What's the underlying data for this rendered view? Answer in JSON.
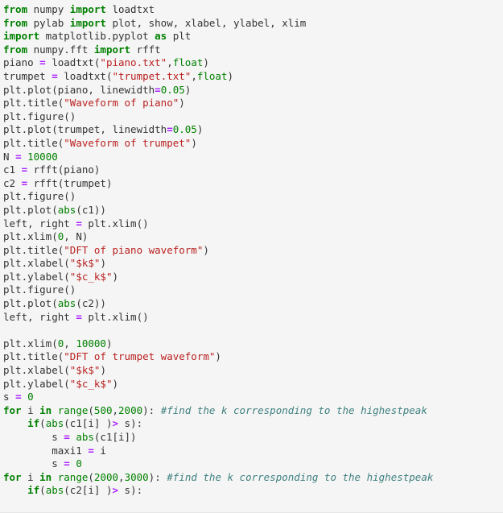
{
  "editor": {
    "language": "python",
    "lines": [
      [
        {
          "t": "kw",
          "v": "from"
        },
        {
          "t": "plain",
          "v": " numpy "
        },
        {
          "t": "kw",
          "v": "import"
        },
        {
          "t": "plain",
          "v": " loadtxt"
        }
      ],
      [
        {
          "t": "kw",
          "v": "from"
        },
        {
          "t": "plain",
          "v": " pylab "
        },
        {
          "t": "kw",
          "v": "import"
        },
        {
          "t": "plain",
          "v": " plot, show, xlabel, ylabel, xlim"
        }
      ],
      [
        {
          "t": "kw",
          "v": "import"
        },
        {
          "t": "plain",
          "v": " matplotlib.pyplot "
        },
        {
          "t": "kw",
          "v": "as"
        },
        {
          "t": "plain",
          "v": " plt"
        }
      ],
      [
        {
          "t": "kw",
          "v": "from"
        },
        {
          "t": "plain",
          "v": " numpy.fft "
        },
        {
          "t": "kw",
          "v": "import"
        },
        {
          "t": "plain",
          "v": " rfft"
        }
      ],
      [
        {
          "t": "plain",
          "v": "piano "
        },
        {
          "t": "op",
          "v": "="
        },
        {
          "t": "plain",
          "v": " loadtxt("
        },
        {
          "t": "str",
          "v": "\"piano.txt\""
        },
        {
          "t": "plain",
          "v": ","
        },
        {
          "t": "bi",
          "v": "float"
        },
        {
          "t": "plain",
          "v": ")"
        }
      ],
      [
        {
          "t": "plain",
          "v": "trumpet "
        },
        {
          "t": "op",
          "v": "="
        },
        {
          "t": "plain",
          "v": " loadtxt("
        },
        {
          "t": "str",
          "v": "\"trumpet.txt\""
        },
        {
          "t": "plain",
          "v": ","
        },
        {
          "t": "bi",
          "v": "float"
        },
        {
          "t": "plain",
          "v": ")"
        }
      ],
      [
        {
          "t": "plain",
          "v": "plt.plot(piano, linewidth"
        },
        {
          "t": "op",
          "v": "="
        },
        {
          "t": "num",
          "v": "0.05"
        },
        {
          "t": "plain",
          "v": ")"
        }
      ],
      [
        {
          "t": "plain",
          "v": "plt.title("
        },
        {
          "t": "str",
          "v": "\"Waveform of piano\""
        },
        {
          "t": "plain",
          "v": ")"
        }
      ],
      [
        {
          "t": "plain",
          "v": "plt.figure()"
        }
      ],
      [
        {
          "t": "plain",
          "v": "plt.plot(trumpet, linewidth"
        },
        {
          "t": "op",
          "v": "="
        },
        {
          "t": "num",
          "v": "0.05"
        },
        {
          "t": "plain",
          "v": ")"
        }
      ],
      [
        {
          "t": "plain",
          "v": "plt.title("
        },
        {
          "t": "str",
          "v": "\"Waveform of trumpet\""
        },
        {
          "t": "plain",
          "v": ")"
        }
      ],
      [
        {
          "t": "plain",
          "v": "N "
        },
        {
          "t": "op",
          "v": "="
        },
        {
          "t": "plain",
          "v": " "
        },
        {
          "t": "num",
          "v": "10000"
        }
      ],
      [
        {
          "t": "plain",
          "v": "c1 "
        },
        {
          "t": "op",
          "v": "="
        },
        {
          "t": "plain",
          "v": " rfft(piano)"
        }
      ],
      [
        {
          "t": "plain",
          "v": "c2 "
        },
        {
          "t": "op",
          "v": "="
        },
        {
          "t": "plain",
          "v": " rfft(trumpet)"
        }
      ],
      [
        {
          "t": "plain",
          "v": "plt.figure()"
        }
      ],
      [
        {
          "t": "plain",
          "v": "plt.plot("
        },
        {
          "t": "bi",
          "v": "abs"
        },
        {
          "t": "plain",
          "v": "(c1))"
        }
      ],
      [
        {
          "t": "plain",
          "v": "left, right "
        },
        {
          "t": "op",
          "v": "="
        },
        {
          "t": "plain",
          "v": " plt.xlim()"
        }
      ],
      [
        {
          "t": "plain",
          "v": "plt.xlim("
        },
        {
          "t": "num",
          "v": "0"
        },
        {
          "t": "plain",
          "v": ", N)"
        }
      ],
      [
        {
          "t": "plain",
          "v": "plt.title("
        },
        {
          "t": "str",
          "v": "\"DFT of piano waveform\""
        },
        {
          "t": "plain",
          "v": ")"
        }
      ],
      [
        {
          "t": "plain",
          "v": "plt.xlabel("
        },
        {
          "t": "str",
          "v": "\"$k$\""
        },
        {
          "t": "plain",
          "v": ")"
        }
      ],
      [
        {
          "t": "plain",
          "v": "plt.ylabel("
        },
        {
          "t": "str",
          "v": "\"$c_k$\""
        },
        {
          "t": "plain",
          "v": ")"
        }
      ],
      [
        {
          "t": "plain",
          "v": "plt.figure()"
        }
      ],
      [
        {
          "t": "plain",
          "v": "plt.plot("
        },
        {
          "t": "bi",
          "v": "abs"
        },
        {
          "t": "plain",
          "v": "(c2))"
        }
      ],
      [
        {
          "t": "plain",
          "v": "left, right "
        },
        {
          "t": "op",
          "v": "="
        },
        {
          "t": "plain",
          "v": " plt.xlim()"
        }
      ],
      [],
      [
        {
          "t": "plain",
          "v": "plt.xlim("
        },
        {
          "t": "num",
          "v": "0"
        },
        {
          "t": "plain",
          "v": ", "
        },
        {
          "t": "num",
          "v": "10000"
        },
        {
          "t": "plain",
          "v": ")"
        }
      ],
      [
        {
          "t": "plain",
          "v": "plt.title("
        },
        {
          "t": "str",
          "v": "\"DFT of trumpet waveform\""
        },
        {
          "t": "plain",
          "v": ")"
        }
      ],
      [
        {
          "t": "plain",
          "v": "plt.xlabel("
        },
        {
          "t": "str",
          "v": "\"$k$\""
        },
        {
          "t": "plain",
          "v": ")"
        }
      ],
      [
        {
          "t": "plain",
          "v": "plt.ylabel("
        },
        {
          "t": "str",
          "v": "\"$c_k$\""
        },
        {
          "t": "plain",
          "v": ")"
        }
      ],
      [
        {
          "t": "plain",
          "v": "s "
        },
        {
          "t": "op",
          "v": "="
        },
        {
          "t": "plain",
          "v": " "
        },
        {
          "t": "num",
          "v": "0"
        }
      ],
      [
        {
          "t": "kw",
          "v": "for"
        },
        {
          "t": "plain",
          "v": " i "
        },
        {
          "t": "kw",
          "v": "in"
        },
        {
          "t": "plain",
          "v": " "
        },
        {
          "t": "bi",
          "v": "range"
        },
        {
          "t": "plain",
          "v": "("
        },
        {
          "t": "num",
          "v": "500"
        },
        {
          "t": "plain",
          "v": ","
        },
        {
          "t": "num",
          "v": "2000"
        },
        {
          "t": "plain",
          "v": "): "
        },
        {
          "t": "com",
          "v": "#find the k corresponding to the highestpeak"
        }
      ],
      [
        {
          "t": "plain",
          "v": "    "
        },
        {
          "t": "kw",
          "v": "if"
        },
        {
          "t": "plain",
          "v": "("
        },
        {
          "t": "bi",
          "v": "abs"
        },
        {
          "t": "plain",
          "v": "(c1[i] )"
        },
        {
          "t": "op",
          "v": ">"
        },
        {
          "t": "plain",
          "v": " s):"
        }
      ],
      [
        {
          "t": "plain",
          "v": "        s "
        },
        {
          "t": "op",
          "v": "="
        },
        {
          "t": "plain",
          "v": " "
        },
        {
          "t": "bi",
          "v": "abs"
        },
        {
          "t": "plain",
          "v": "(c1[i])"
        }
      ],
      [
        {
          "t": "plain",
          "v": "        maxi1 "
        },
        {
          "t": "op",
          "v": "="
        },
        {
          "t": "plain",
          "v": " i"
        }
      ],
      [
        {
          "t": "plain",
          "v": "        s "
        },
        {
          "t": "op",
          "v": "="
        },
        {
          "t": "plain",
          "v": " "
        },
        {
          "t": "num",
          "v": "0"
        }
      ],
      [
        {
          "t": "kw",
          "v": "for"
        },
        {
          "t": "plain",
          "v": " i "
        },
        {
          "t": "kw",
          "v": "in"
        },
        {
          "t": "plain",
          "v": " "
        },
        {
          "t": "bi",
          "v": "range"
        },
        {
          "t": "plain",
          "v": "("
        },
        {
          "t": "num",
          "v": "2000"
        },
        {
          "t": "plain",
          "v": ","
        },
        {
          "t": "num",
          "v": "3000"
        },
        {
          "t": "plain",
          "v": "): "
        },
        {
          "t": "com",
          "v": "#find the k corresponding to the highestpeak"
        }
      ],
      [
        {
          "t": "plain",
          "v": "    "
        },
        {
          "t": "kw",
          "v": "if"
        },
        {
          "t": "plain",
          "v": "("
        },
        {
          "t": "bi",
          "v": "abs"
        },
        {
          "t": "plain",
          "v": "(c2[i] )"
        },
        {
          "t": "op",
          "v": ">"
        },
        {
          "t": "plain",
          "v": " s):"
        }
      ]
    ]
  },
  "colors": {
    "background": "#f5f5f5",
    "keyword": "#008000",
    "string": "#ba2121",
    "number": "#008000",
    "operator": "#aa22ff",
    "comment": "#408080",
    "text": "#333333"
  }
}
